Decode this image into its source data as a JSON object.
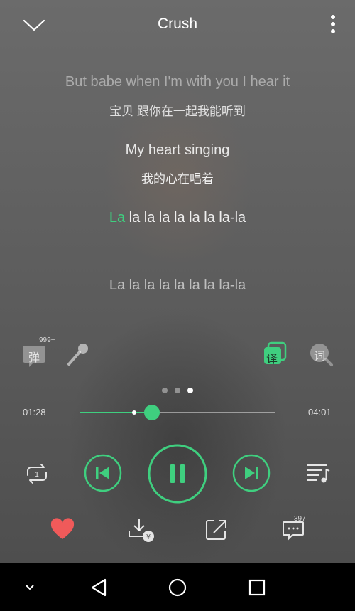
{
  "header": {
    "title": "Crush"
  },
  "lyrics": {
    "line1_en": "But babe when I'm with you I hear it",
    "line1_cn": "宝贝 跟你在一起我能听到",
    "line2_en": "My heart singing",
    "line2_cn": "我的心在唱着",
    "line3_highlight": "La",
    "line3_rest": " la la la la la la la-la",
    "line4_en": "La la la la la la la la-la"
  },
  "tools": {
    "danmaku_label": "弹",
    "danmaku_count": "999+",
    "translate_label": "译",
    "lyrics_label": "词"
  },
  "pager": {
    "pages": 3,
    "active": 3
  },
  "progress": {
    "current": "01:28",
    "total": "04:01",
    "played_fraction": 0.37,
    "buffered_fraction": 0.28
  },
  "actions": {
    "comment_count": "397"
  },
  "colors": {
    "accent": "#3fcf7f",
    "like": "#f05a5a"
  },
  "icons": [
    "chevron-down-icon",
    "more-vertical-icon",
    "danmaku-icon",
    "microphone-icon",
    "translate-icon",
    "lyrics-search-icon",
    "repeat-one-icon",
    "previous-icon",
    "pause-icon",
    "next-icon",
    "playlist-icon",
    "heart-icon",
    "download-icon",
    "share-icon",
    "comment-icon",
    "nav-down-icon",
    "nav-back-icon",
    "nav-home-icon",
    "nav-recents-icon"
  ]
}
